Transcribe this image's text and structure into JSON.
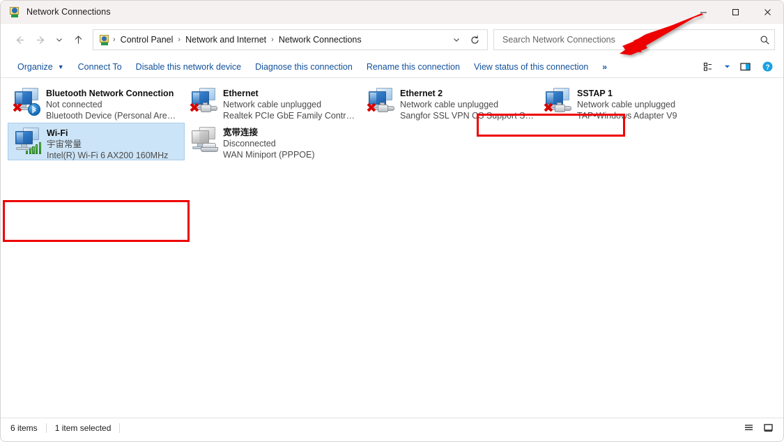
{
  "window": {
    "title": "Network Connections",
    "icon": "network-connections-icon",
    "controls": {
      "minimize": "minimize-button",
      "maximize": "maximize-button",
      "close": "close-button"
    }
  },
  "navbar": {
    "back": "Back",
    "forward": "Forward",
    "recent": "Recent locations",
    "up": "Up",
    "breadcrumb": {
      "icon": "control-panel-icon",
      "items": [
        "Control Panel",
        "Network and Internet",
        "Network Connections"
      ],
      "separator": "›"
    },
    "dropdown": "Previous locations",
    "refresh": "Refresh"
  },
  "search": {
    "placeholder": "Search Network Connections",
    "value": "",
    "icon": "search-icon"
  },
  "toolbar": {
    "items": [
      {
        "label": "Organize",
        "has_caret": true
      },
      {
        "label": "Connect To",
        "has_caret": false
      },
      {
        "label": "Disable this network device",
        "has_caret": false
      },
      {
        "label": "Diagnose this connection",
        "has_caret": false
      },
      {
        "label": "Rename this connection",
        "has_caret": false
      },
      {
        "label": "View status of this connection",
        "has_caret": false
      }
    ],
    "overflow": "»",
    "view_options_icon": "view-options-icon",
    "view_options_caret": "▾",
    "preview_pane_icon": "preview-pane-icon",
    "help_icon": "help-icon",
    "highlighted_item": "View status of this connection"
  },
  "connections": [
    {
      "name": "Bluetooth Network Connection",
      "status": "Not connected",
      "device": "Bluetooth Device (Personal Area ...",
      "icon": "network-adapter-icon",
      "badge": "bluetooth",
      "disabled_badge": true,
      "selected": false
    },
    {
      "name": "Ethernet",
      "status": "Network cable unplugged",
      "device": "Realtek PCIe GbE Family Controller",
      "icon": "network-adapter-icon",
      "badge": "rj45-plug",
      "disabled_badge": true,
      "selected": false
    },
    {
      "name": "Ethernet 2",
      "status": "Network cable unplugged",
      "device": "Sangfor SSL VPN CS Support Syst...",
      "icon": "network-adapter-icon",
      "badge": "rj45-plug",
      "disabled_badge": true,
      "selected": false
    },
    {
      "name": "SSTAP 1",
      "status": "Network cable unplugged",
      "device": "TAP-Windows Adapter V9",
      "icon": "network-adapter-icon",
      "badge": "rj45-plug",
      "disabled_badge": true,
      "selected": false
    },
    {
      "name": "Wi-Fi",
      "status": "宇宙常量",
      "device": "Intel(R) Wi-Fi 6 AX200 160MHz",
      "icon": "network-adapter-icon",
      "badge": "wifi-signal",
      "disabled_badge": false,
      "selected": true
    },
    {
      "name": "宽带连接",
      "status": "Disconnected",
      "device": "WAN Miniport (PPPOE)",
      "icon": "modem-adapter-icon",
      "badge": "modem",
      "disabled_badge": false,
      "selected": false
    }
  ],
  "statusbar": {
    "item_count": "6 items",
    "selection": "1 item selected",
    "details_view_icon": "details-view-icon",
    "large-icons_view_icon": "large-icons-view-icon"
  },
  "annotations": {
    "arrow_color": "#ee0000",
    "highlight_color": "#ee0000",
    "arrow_target": "search-box",
    "highlight_targets": [
      "view-status-of-this-connection",
      "wifi-connection-tile"
    ]
  },
  "colors": {
    "accent": "#11519b",
    "selection": "#cce4f7",
    "annotation": "#ee0000",
    "titlebar": "#f6f1f1"
  }
}
